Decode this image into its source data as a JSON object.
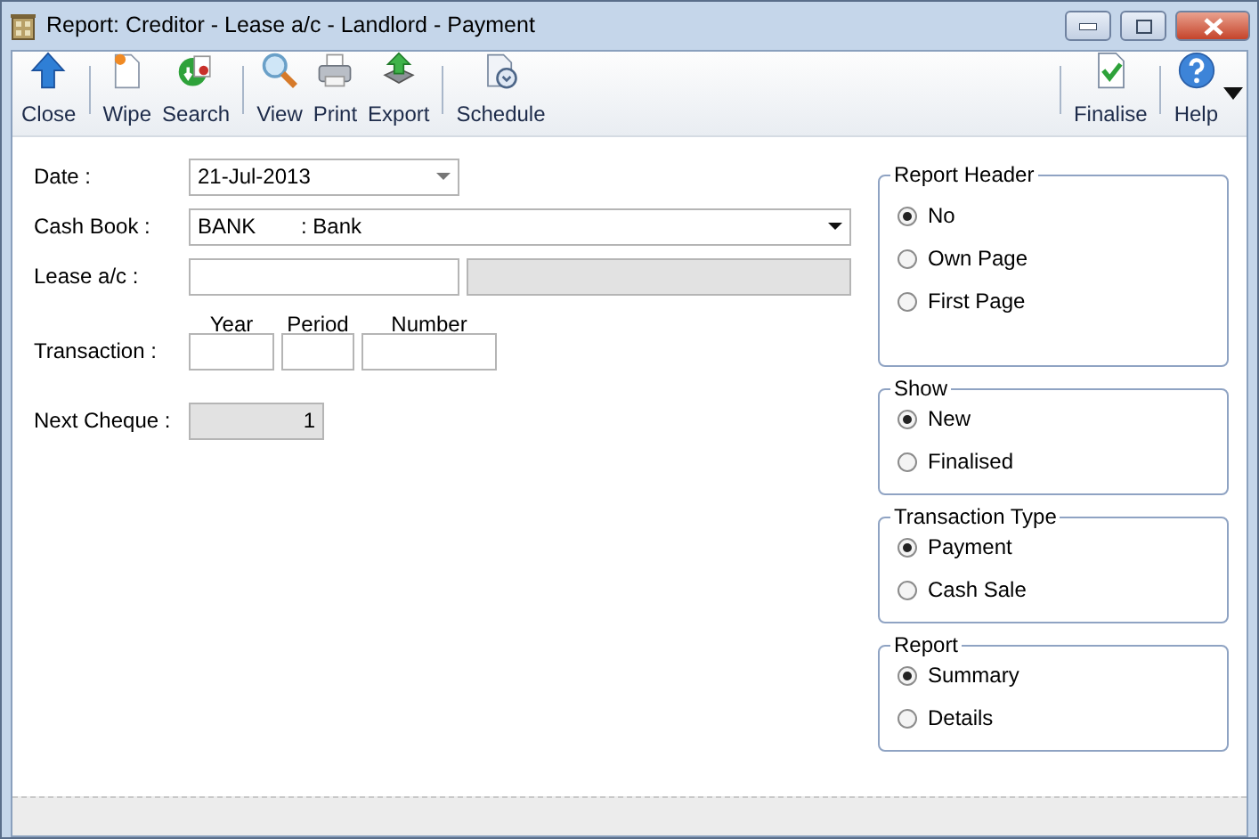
{
  "window": {
    "title": "Report: Creditor - Lease a/c - Landlord - Payment"
  },
  "toolbar": [
    {
      "label": "Close",
      "sep_before": false
    },
    {
      "label": "Wipe",
      "sep_before": true
    },
    {
      "label": "Search",
      "sep_before": false
    },
    {
      "label": "View",
      "sep_before": true
    },
    {
      "label": "Print",
      "sep_before": false
    },
    {
      "label": "Export",
      "sep_before": false
    },
    {
      "label": "Schedule",
      "sep_before": true
    }
  ],
  "toolbar_right": [
    {
      "label": "Finalise",
      "sep_before": true
    },
    {
      "label": "Help",
      "sep_before": true
    }
  ],
  "form": {
    "date": {
      "label": "Date :",
      "value": "21-Jul-2013"
    },
    "cash_book": {
      "label": "Cash Book :",
      "code": "BANK",
      "name": ": Bank"
    },
    "lease": {
      "label": "Lease a/c :"
    },
    "transaction": {
      "label": "Transaction :",
      "columns": [
        "Year",
        "Period",
        "Number"
      ]
    },
    "next_cheque": {
      "label": "Next Cheque :",
      "value": "1"
    }
  },
  "groups": [
    {
      "title": "Report Header",
      "options": [
        {
          "label": "No",
          "selected": true
        },
        {
          "label": "Own Page",
          "selected": false
        },
        {
          "label": "First Page",
          "selected": false
        }
      ]
    },
    {
      "title": "Show",
      "options": [
        {
          "label": "New",
          "selected": true
        },
        {
          "label": "Finalised",
          "selected": false
        }
      ]
    },
    {
      "title": "Transaction Type",
      "options": [
        {
          "label": "Payment",
          "selected": true
        },
        {
          "label": "Cash Sale",
          "selected": false
        }
      ]
    },
    {
      "title": "Report",
      "options": [
        {
          "label": "Summary",
          "selected": true
        },
        {
          "label": "Details",
          "selected": false
        }
      ]
    }
  ]
}
